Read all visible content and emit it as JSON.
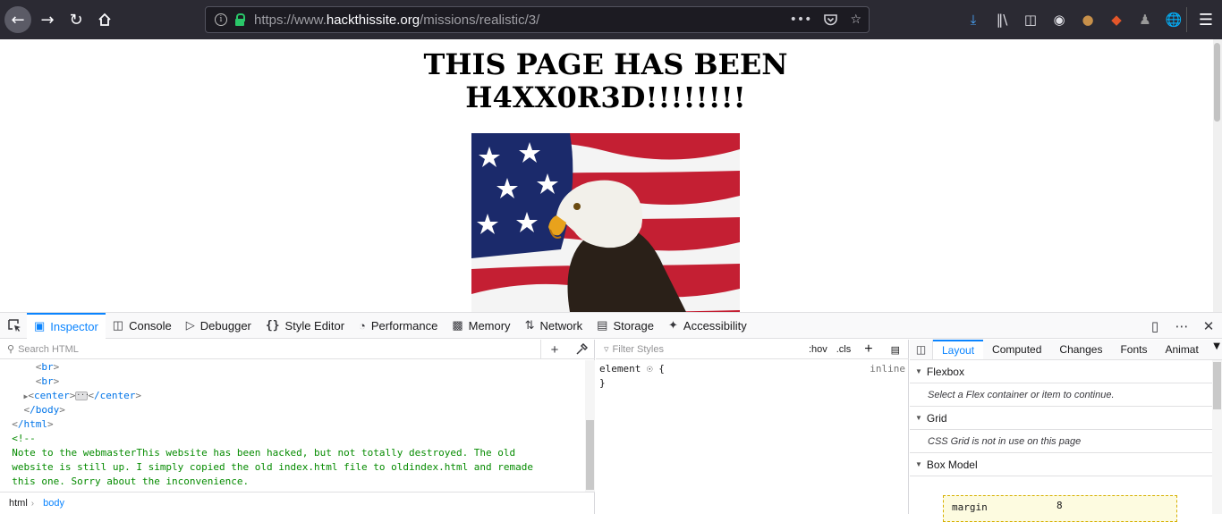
{
  "browser": {
    "url_prefix": "https://www.",
    "url_host": "hackthissite.org",
    "url_path": "/missions/realistic/3/",
    "url_more_icon": "•••"
  },
  "page": {
    "title_line1": "THIS PAGE HAS BEEN",
    "title_line2": "H4XX0R3D!!!!!!!!"
  },
  "devtools": {
    "tabs": [
      {
        "label": "Inspector",
        "icon": "inspector-icon"
      },
      {
        "label": "Console",
        "icon": "console-icon"
      },
      {
        "label": "Debugger",
        "icon": "debugger-icon"
      },
      {
        "label": "Style Editor",
        "icon": "style-editor-icon"
      },
      {
        "label": "Performance",
        "icon": "performance-icon"
      },
      {
        "label": "Memory",
        "icon": "memory-icon"
      },
      {
        "label": "Network",
        "icon": "network-icon"
      },
      {
        "label": "Storage",
        "icon": "storage-icon"
      },
      {
        "label": "Accessibility",
        "icon": "accessibility-icon"
      }
    ],
    "search_html_placeholder": "Search HTML",
    "markup": {
      "br1": "br",
      "br2": "br",
      "center_open": "center",
      "center_close": "/center",
      "body_close": "/body",
      "html_close": "/html",
      "comment_open": "<!--",
      "comment_l1": "Note to the webmasterThis website has been hacked, but not totally destroyed. The old",
      "comment_l2": "website is still up. I simply copied the old index.html file to oldindex.html and remade",
      "comment_l3": "this one. Sorry about the inconvenience.",
      "comment_close": "-->"
    },
    "breadcrumb": [
      "html",
      "body"
    ],
    "filter_styles_placeholder": "Filter Styles",
    "hov": ":hov",
    "cls": ".cls",
    "rule_selector": "element",
    "rule_open": "{",
    "rule_close": "}",
    "rule_source": "inline",
    "right_tabs": [
      "Layout",
      "Computed",
      "Changes",
      "Fonts",
      "Animat"
    ],
    "flexbox": {
      "title": "Flexbox",
      "message": "Select a Flex container or item to continue."
    },
    "grid": {
      "title": "Grid",
      "message": "CSS Grid is not in use on this page"
    },
    "box_model": {
      "title": "Box Model",
      "margin_label": "margin",
      "margin_value": "8"
    }
  }
}
